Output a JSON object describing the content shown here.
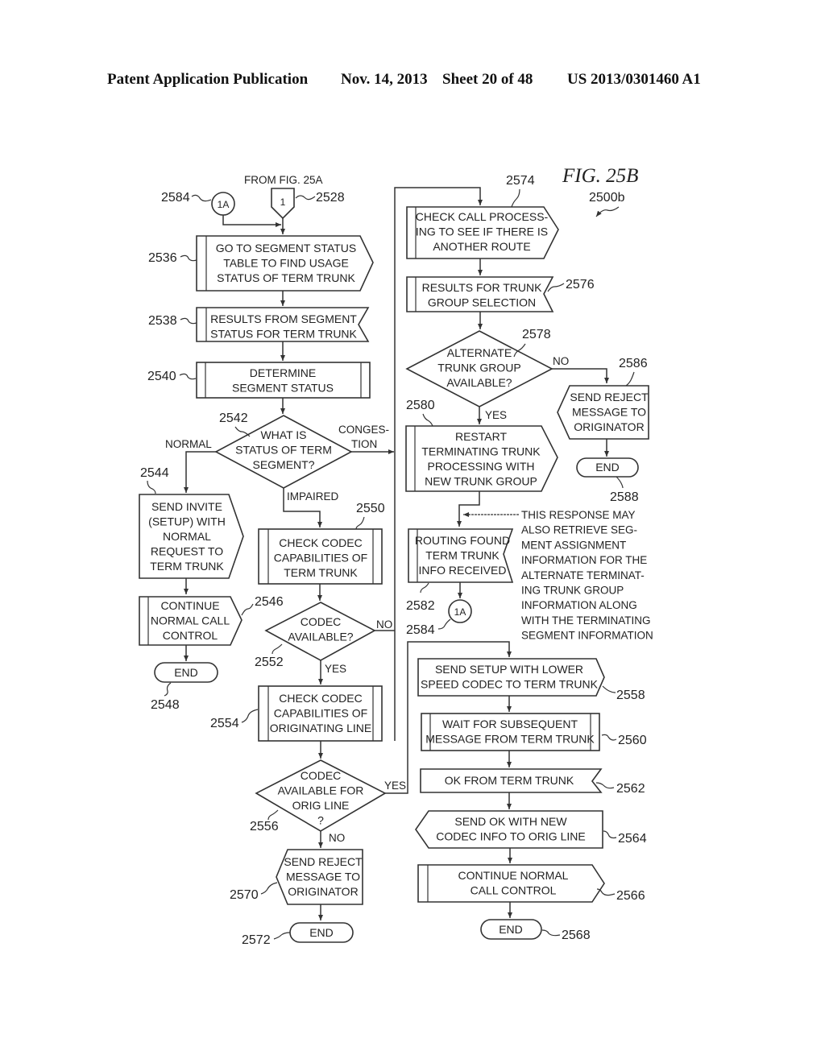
{
  "header": {
    "publication": "Patent Application Publication",
    "date": "Nov. 14, 2013",
    "sheet": "Sheet 20 of 48",
    "number": "US 2013/0301460 A1"
  },
  "figure": {
    "title": "FIG. 25B",
    "ref": "2500b",
    "from_label": "FROM FIG. 25A"
  },
  "connectors": {
    "c2584_top": {
      "ref": "2584",
      "text": "1A"
    },
    "c2528": {
      "ref": "2528",
      "text": "1"
    },
    "c2584_bottom": {
      "ref": "2584",
      "text": "1A"
    }
  },
  "nodes": {
    "n2536": {
      "ref": "2536",
      "lines": [
        "GO TO SEGMENT STATUS",
        "TABLE TO FIND USAGE",
        "STATUS OF TERM TRUNK"
      ]
    },
    "n2538": {
      "ref": "2538",
      "lines": [
        "RESULTS FROM SEGMENT",
        "STATUS FOR TERM TRUNK"
      ]
    },
    "n2540": {
      "ref": "2540",
      "lines": [
        "DETERMINE",
        "SEGMENT STATUS"
      ]
    },
    "n2542": {
      "ref": "2542",
      "lines": [
        "WHAT IS",
        "STATUS OF TERM",
        "SEGMENT?"
      ]
    },
    "n2544": {
      "ref": "2544",
      "lines": [
        "SEND INVITE",
        "(SETUP) WITH",
        "NORMAL",
        "REQUEST TO",
        "TERM TRUNK"
      ]
    },
    "n2546": {
      "ref": "2546",
      "lines": [
        "CONTINUE",
        "NORMAL CALL",
        "CONTROL"
      ]
    },
    "n2548": {
      "ref": "2548",
      "lines": [
        "END"
      ]
    },
    "n2550": {
      "ref": "2550",
      "lines": [
        "CHECK CODEC",
        "CAPABILITIES OF",
        "TERM TRUNK"
      ]
    },
    "n2552": {
      "ref": "2552",
      "lines": [
        "CODEC",
        "AVAILABLE?"
      ]
    },
    "n2554": {
      "ref": "2554",
      "lines": [
        "CHECK CODEC",
        "CAPABILITIES OF",
        "ORIGINATING LINE"
      ]
    },
    "n2556": {
      "ref": "2556",
      "lines": [
        "CODEC",
        "AVAILABLE FOR",
        "ORIG LINE",
        "?"
      ]
    },
    "n2570": {
      "ref": "2570",
      "lines": [
        "SEND REJECT",
        "MESSAGE TO",
        "ORIGINATOR"
      ]
    },
    "n2572": {
      "ref": "2572",
      "lines": [
        "END"
      ]
    },
    "n2574": {
      "ref": "2574",
      "lines": [
        "CHECK CALL PROCESS-",
        "ING TO SEE IF THERE IS",
        "ANOTHER ROUTE"
      ]
    },
    "n2576": {
      "ref": "2576",
      "lines": [
        "RESULTS FOR TRUNK",
        "GROUP SELECTION"
      ]
    },
    "n2578": {
      "ref": "2578",
      "lines": [
        "ALTERNATE",
        "TRUNK GROUP",
        "AVAILABLE?"
      ]
    },
    "n2580": {
      "ref": "2580",
      "lines": [
        "RESTART",
        "TERMINATING TRUNK",
        "PROCESSING WITH",
        "NEW TRUNK GROUP"
      ]
    },
    "n2586": {
      "ref": "2586",
      "lines": [
        "SEND REJECT",
        "MESSAGE TO",
        "ORIGINATOR"
      ]
    },
    "n2588": {
      "ref": "2588",
      "lines": [
        "END"
      ]
    },
    "n2582": {
      "ref": "2582",
      "lines": [
        "ROUTING FOUND",
        "TERM TRUNK",
        "INFO RECEIVED"
      ]
    },
    "n2558": {
      "ref": "2558",
      "lines": [
        "SEND SETUP WITH LOWER",
        "SPEED CODEC TO TERM TRUNK"
      ]
    },
    "n2560": {
      "ref": "2560",
      "lines": [
        "WAIT FOR SUBSEQUENT",
        "MESSAGE FROM TERM TRUNK"
      ]
    },
    "n2562": {
      "ref": "2562",
      "lines": [
        "OK FROM TERM TRUNK"
      ]
    },
    "n2564": {
      "ref": "2564",
      "lines": [
        "SEND OK WITH NEW",
        "CODEC INFO TO ORIG LINE"
      ]
    },
    "n2566": {
      "ref": "2566",
      "lines": [
        "CONTINUE NORMAL",
        "CALL CONTROL"
      ]
    },
    "n2568": {
      "ref": "2568",
      "lines": [
        "END"
      ]
    }
  },
  "edge_labels": {
    "normal": "NORMAL",
    "congestion": [
      "CONGES-",
      "TION"
    ],
    "impaired": "IMPAIRED",
    "no_2552": "NO",
    "yes_2552": "YES",
    "yes_2556": "YES",
    "no_2556": "NO",
    "no_2578": "NO",
    "yes_2578": "YES"
  },
  "annotation": {
    "lines": [
      "THIS RESPONSE MAY",
      "ALSO RETRIEVE SEG-",
      "MENT ASSIGNMENT",
      "INFORMATION FOR THE",
      "ALTERNATE TERMINAT-",
      "ING TRUNK GROUP",
      "INFORMATION ALONG",
      "WITH THE TERMINATING",
      "SEGMENT INFORMATION"
    ]
  }
}
